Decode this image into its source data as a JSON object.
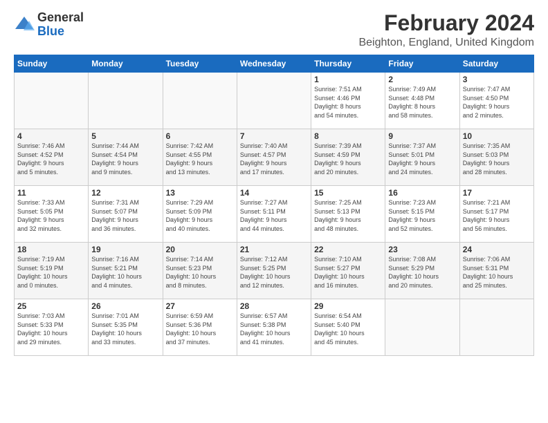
{
  "logo": {
    "general": "General",
    "blue": "Blue"
  },
  "title": "February 2024",
  "subtitle": "Beighton, England, United Kingdom",
  "weekdays": [
    "Sunday",
    "Monday",
    "Tuesday",
    "Wednesday",
    "Thursday",
    "Friday",
    "Saturday"
  ],
  "weeks": [
    [
      {
        "day": "",
        "info": ""
      },
      {
        "day": "",
        "info": ""
      },
      {
        "day": "",
        "info": ""
      },
      {
        "day": "",
        "info": ""
      },
      {
        "day": "1",
        "info": "Sunrise: 7:51 AM\nSunset: 4:46 PM\nDaylight: 8 hours\nand 54 minutes."
      },
      {
        "day": "2",
        "info": "Sunrise: 7:49 AM\nSunset: 4:48 PM\nDaylight: 8 hours\nand 58 minutes."
      },
      {
        "day": "3",
        "info": "Sunrise: 7:47 AM\nSunset: 4:50 PM\nDaylight: 9 hours\nand 2 minutes."
      }
    ],
    [
      {
        "day": "4",
        "info": "Sunrise: 7:46 AM\nSunset: 4:52 PM\nDaylight: 9 hours\nand 5 minutes."
      },
      {
        "day": "5",
        "info": "Sunrise: 7:44 AM\nSunset: 4:54 PM\nDaylight: 9 hours\nand 9 minutes."
      },
      {
        "day": "6",
        "info": "Sunrise: 7:42 AM\nSunset: 4:55 PM\nDaylight: 9 hours\nand 13 minutes."
      },
      {
        "day": "7",
        "info": "Sunrise: 7:40 AM\nSunset: 4:57 PM\nDaylight: 9 hours\nand 17 minutes."
      },
      {
        "day": "8",
        "info": "Sunrise: 7:39 AM\nSunset: 4:59 PM\nDaylight: 9 hours\nand 20 minutes."
      },
      {
        "day": "9",
        "info": "Sunrise: 7:37 AM\nSunset: 5:01 PM\nDaylight: 9 hours\nand 24 minutes."
      },
      {
        "day": "10",
        "info": "Sunrise: 7:35 AM\nSunset: 5:03 PM\nDaylight: 9 hours\nand 28 minutes."
      }
    ],
    [
      {
        "day": "11",
        "info": "Sunrise: 7:33 AM\nSunset: 5:05 PM\nDaylight: 9 hours\nand 32 minutes."
      },
      {
        "day": "12",
        "info": "Sunrise: 7:31 AM\nSunset: 5:07 PM\nDaylight: 9 hours\nand 36 minutes."
      },
      {
        "day": "13",
        "info": "Sunrise: 7:29 AM\nSunset: 5:09 PM\nDaylight: 9 hours\nand 40 minutes."
      },
      {
        "day": "14",
        "info": "Sunrise: 7:27 AM\nSunset: 5:11 PM\nDaylight: 9 hours\nand 44 minutes."
      },
      {
        "day": "15",
        "info": "Sunrise: 7:25 AM\nSunset: 5:13 PM\nDaylight: 9 hours\nand 48 minutes."
      },
      {
        "day": "16",
        "info": "Sunrise: 7:23 AM\nSunset: 5:15 PM\nDaylight: 9 hours\nand 52 minutes."
      },
      {
        "day": "17",
        "info": "Sunrise: 7:21 AM\nSunset: 5:17 PM\nDaylight: 9 hours\nand 56 minutes."
      }
    ],
    [
      {
        "day": "18",
        "info": "Sunrise: 7:19 AM\nSunset: 5:19 PM\nDaylight: 10 hours\nand 0 minutes."
      },
      {
        "day": "19",
        "info": "Sunrise: 7:16 AM\nSunset: 5:21 PM\nDaylight: 10 hours\nand 4 minutes."
      },
      {
        "day": "20",
        "info": "Sunrise: 7:14 AM\nSunset: 5:23 PM\nDaylight: 10 hours\nand 8 minutes."
      },
      {
        "day": "21",
        "info": "Sunrise: 7:12 AM\nSunset: 5:25 PM\nDaylight: 10 hours\nand 12 minutes."
      },
      {
        "day": "22",
        "info": "Sunrise: 7:10 AM\nSunset: 5:27 PM\nDaylight: 10 hours\nand 16 minutes."
      },
      {
        "day": "23",
        "info": "Sunrise: 7:08 AM\nSunset: 5:29 PM\nDaylight: 10 hours\nand 20 minutes."
      },
      {
        "day": "24",
        "info": "Sunrise: 7:06 AM\nSunset: 5:31 PM\nDaylight: 10 hours\nand 25 minutes."
      }
    ],
    [
      {
        "day": "25",
        "info": "Sunrise: 7:03 AM\nSunset: 5:33 PM\nDaylight: 10 hours\nand 29 minutes."
      },
      {
        "day": "26",
        "info": "Sunrise: 7:01 AM\nSunset: 5:35 PM\nDaylight: 10 hours\nand 33 minutes."
      },
      {
        "day": "27",
        "info": "Sunrise: 6:59 AM\nSunset: 5:36 PM\nDaylight: 10 hours\nand 37 minutes."
      },
      {
        "day": "28",
        "info": "Sunrise: 6:57 AM\nSunset: 5:38 PM\nDaylight: 10 hours\nand 41 minutes."
      },
      {
        "day": "29",
        "info": "Sunrise: 6:54 AM\nSunset: 5:40 PM\nDaylight: 10 hours\nand 45 minutes."
      },
      {
        "day": "",
        "info": ""
      },
      {
        "day": "",
        "info": ""
      }
    ]
  ]
}
